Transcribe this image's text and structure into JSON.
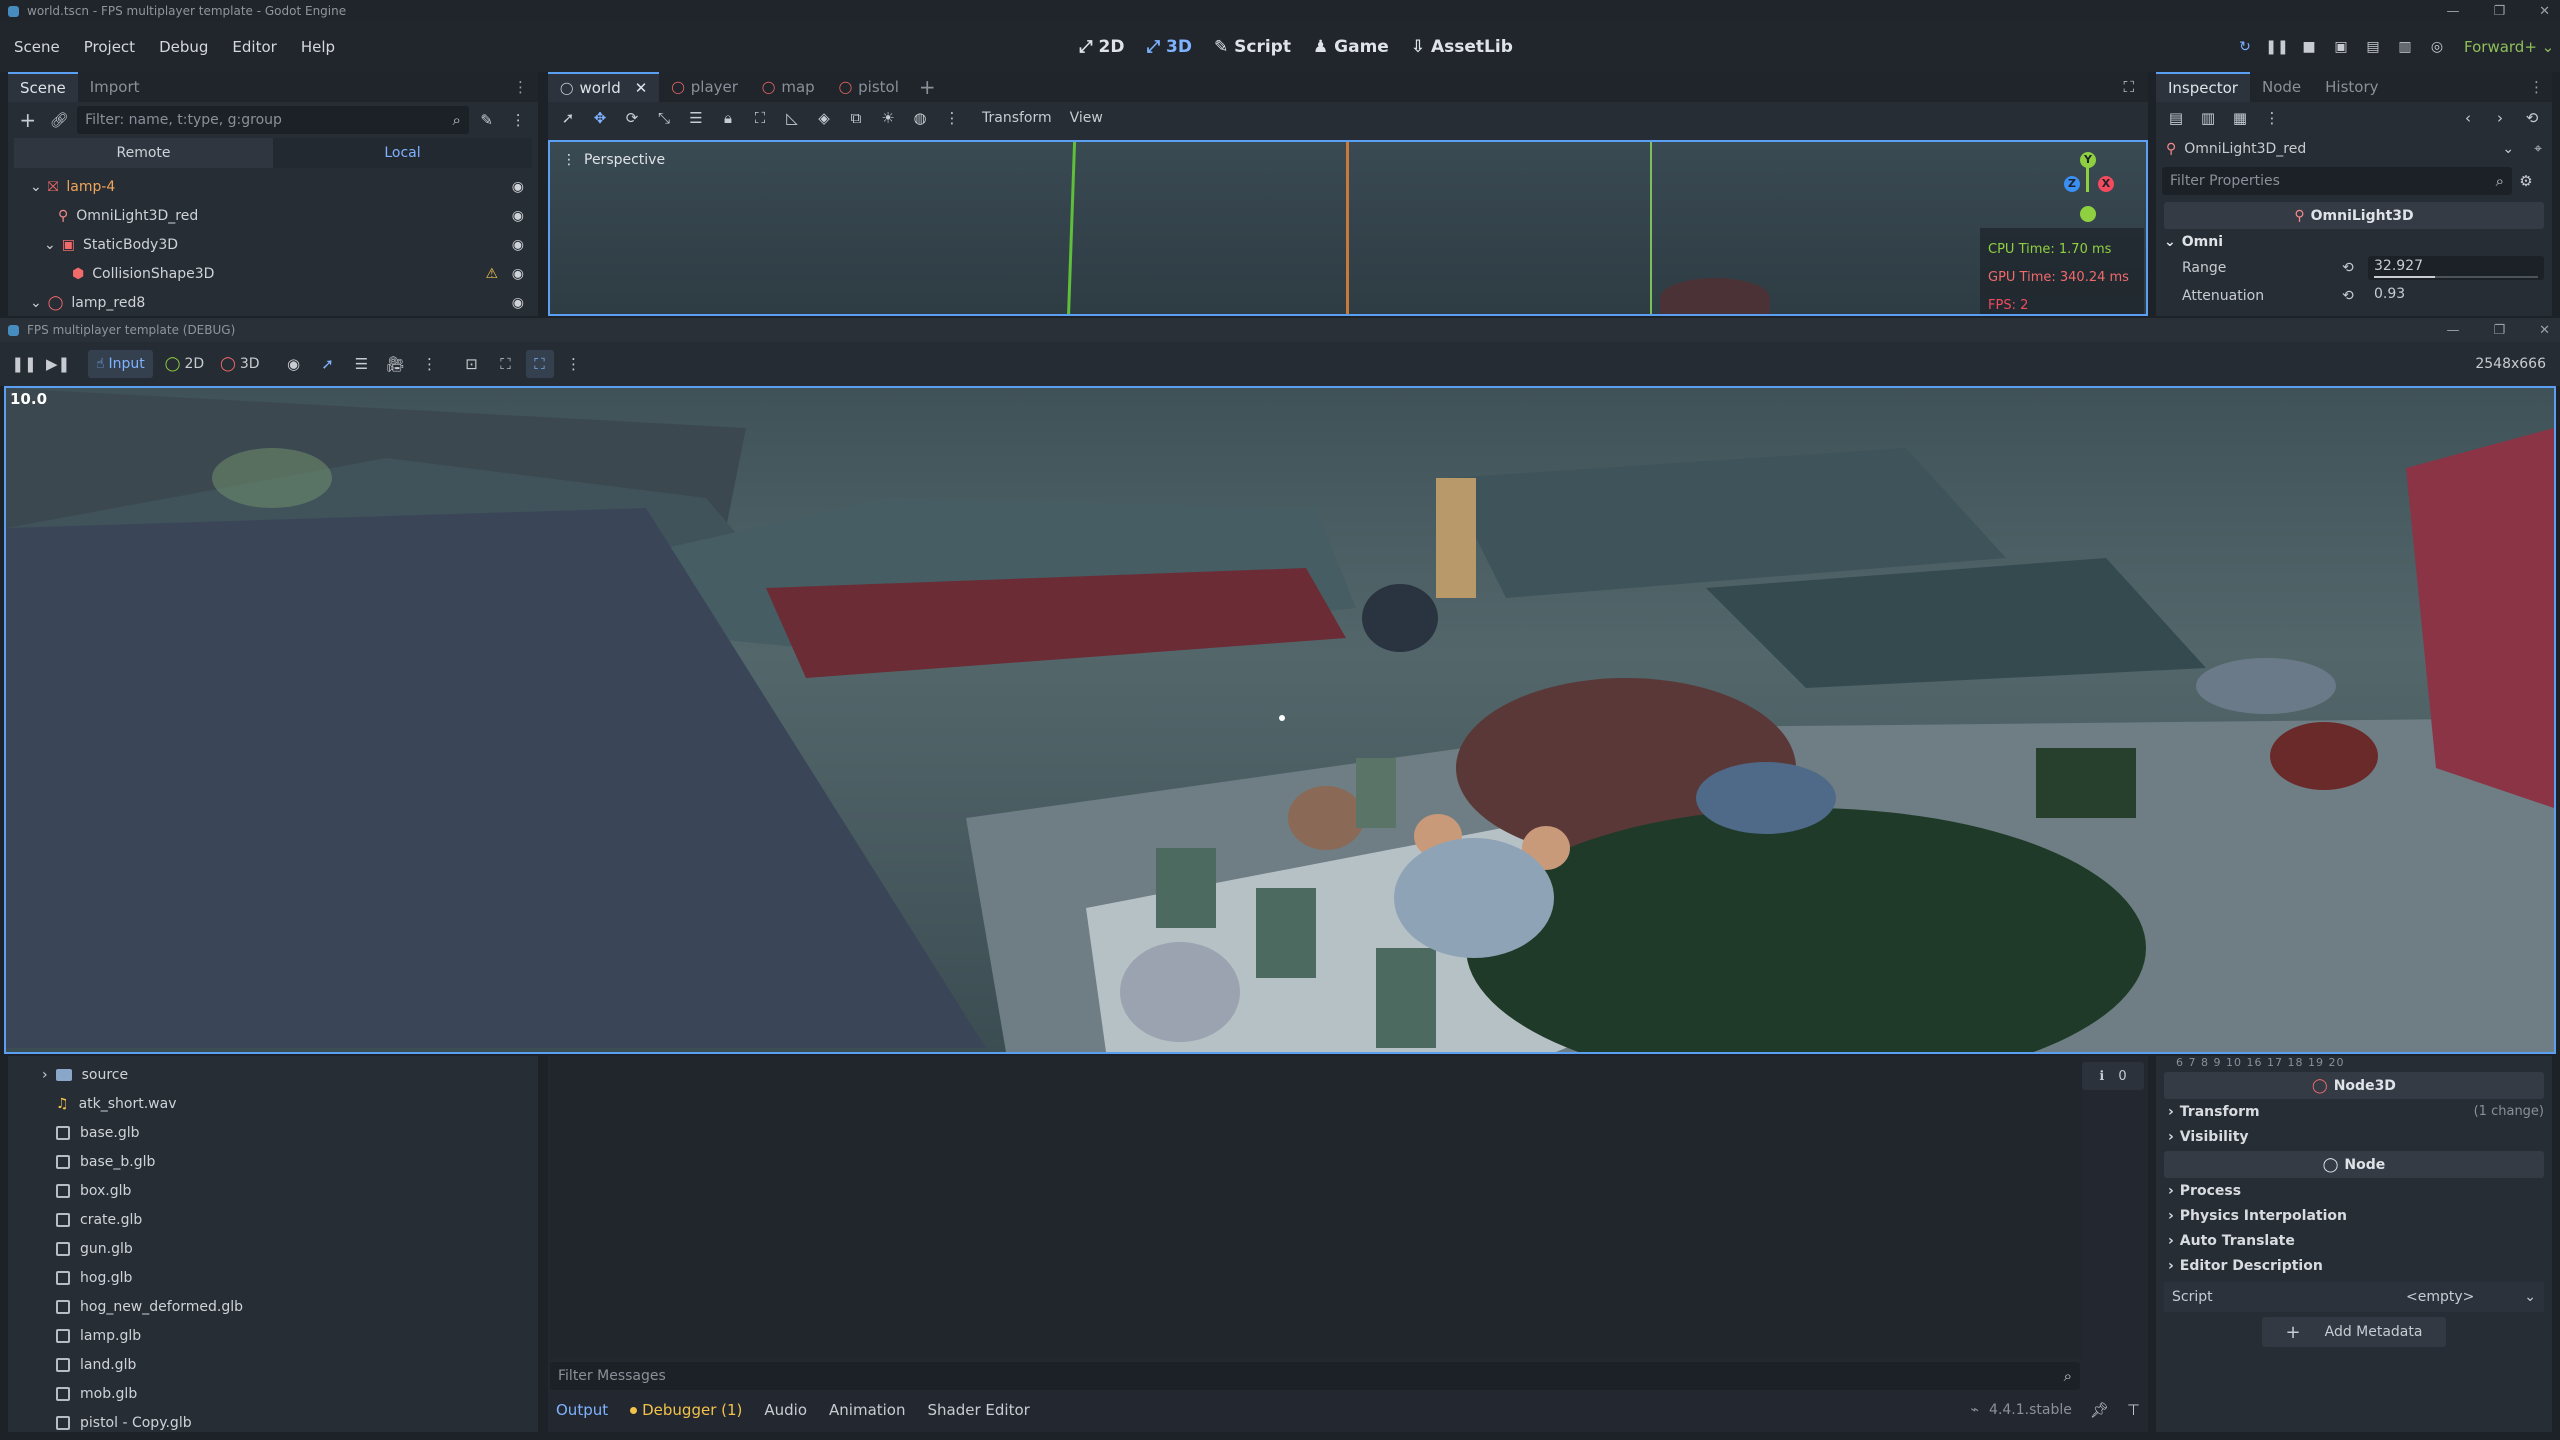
{
  "window": {
    "title": "world.tscn - FPS multiplayer template - Godot Engine"
  },
  "menu": [
    "Scene",
    "Project",
    "Debug",
    "Editor",
    "Help"
  ],
  "modes": [
    {
      "label": "2D",
      "icon": "2d-icon"
    },
    {
      "label": "3D",
      "icon": "3d-icon"
    },
    {
      "label": "Script",
      "icon": "script-icon"
    },
    {
      "label": "Game",
      "icon": "game-icon"
    },
    {
      "label": "AssetLib",
      "icon": "assetlib-icon"
    }
  ],
  "renderer": "Forward+",
  "scene_dock": {
    "tabs": [
      "Scene",
      "Import"
    ],
    "filter_placeholder": "Filter: name, t:type, g:group",
    "remote_label": "Remote",
    "local_label": "Local",
    "tree": [
      {
        "label": "lamp-4",
        "color": "#f2a45a",
        "indent": 0,
        "icon": "scene-node-icon"
      },
      {
        "label": "OmniLight3D_red",
        "color": "#cfd3d8",
        "indent": 1,
        "icon": "omnilight-icon"
      },
      {
        "label": "StaticBody3D",
        "color": "#cfd3d8",
        "indent": 1,
        "icon": "staticbody-icon"
      },
      {
        "label": "CollisionShape3D",
        "color": "#cfd3d8",
        "indent": 2,
        "icon": "collisionshape-icon"
      },
      {
        "label": "lamp_red8",
        "color": "#cfd3d8",
        "indent": 0,
        "icon": "node3d-icon"
      }
    ]
  },
  "editor_tabs": [
    "world",
    "player",
    "map",
    "pistol"
  ],
  "viewport_toolbar": {
    "transform": "Transform",
    "view": "View"
  },
  "viewport": {
    "perspective_label": "Perspective",
    "cpu_time": "CPU Time: 1.70 ms",
    "gpu_time": "GPU Time: 340.24 ms",
    "fps": "FPS: 2",
    "gizmo": {
      "x": "X",
      "y": "Y",
      "z": "Z"
    }
  },
  "inspector": {
    "tabs": [
      "Inspector",
      "Node",
      "History"
    ],
    "node_name": "OmniLight3D_red",
    "filter_placeholder": "Filter Properties",
    "class_header": "OmniLight3D",
    "omni_section": "Omni",
    "properties": [
      {
        "label": "Range",
        "value": "32.927"
      },
      {
        "label": "Attenuation",
        "value": "0.93"
      }
    ],
    "layer_numbers": "6  7  8  9  10  16  17  18  19  20",
    "node3d_header": "Node3D",
    "node3d_sections": [
      {
        "label": "Transform",
        "note": "(1 change)"
      },
      {
        "label": "Visibility",
        "note": ""
      }
    ],
    "node_header": "Node",
    "node_sections": [
      "Process",
      "Physics Interpolation",
      "Auto Translate",
      "Editor Description"
    ],
    "script_label": "Script",
    "script_value": "<empty>",
    "add_metadata": "Add Metadata"
  },
  "game_window": {
    "title": "FPS multiplayer template (DEBUG)",
    "input_label": "Input",
    "mode_2d": "2D",
    "mode_3d": "3D",
    "resolution": "2548x666",
    "fps_overlay": "10.0"
  },
  "filesystem": {
    "items": [
      {
        "label": "source",
        "type": "folder"
      },
      {
        "label": "atk_short.wav",
        "type": "audio"
      },
      {
        "label": "base.glb",
        "type": "file"
      },
      {
        "label": "base_b.glb",
        "type": "file"
      },
      {
        "label": "box.glb",
        "type": "file"
      },
      {
        "label": "crate.glb",
        "type": "file"
      },
      {
        "label": "gun.glb",
        "type": "file"
      },
      {
        "label": "hog.glb",
        "type": "file"
      },
      {
        "label": "hog_new_deformed.glb",
        "type": "file"
      },
      {
        "label": "lamp.glb",
        "type": "file"
      },
      {
        "label": "land.glb",
        "type": "file"
      },
      {
        "label": "mob.glb",
        "type": "file"
      },
      {
        "label": "pistol - Copy.glb",
        "type": "file"
      }
    ]
  },
  "output": {
    "message_count": "0",
    "filter_placeholder": "Filter Messages",
    "tabs": [
      "Output",
      "Debugger (1)",
      "Audio",
      "Animation",
      "Shader Editor"
    ],
    "version": "4.4.1.stable"
  }
}
